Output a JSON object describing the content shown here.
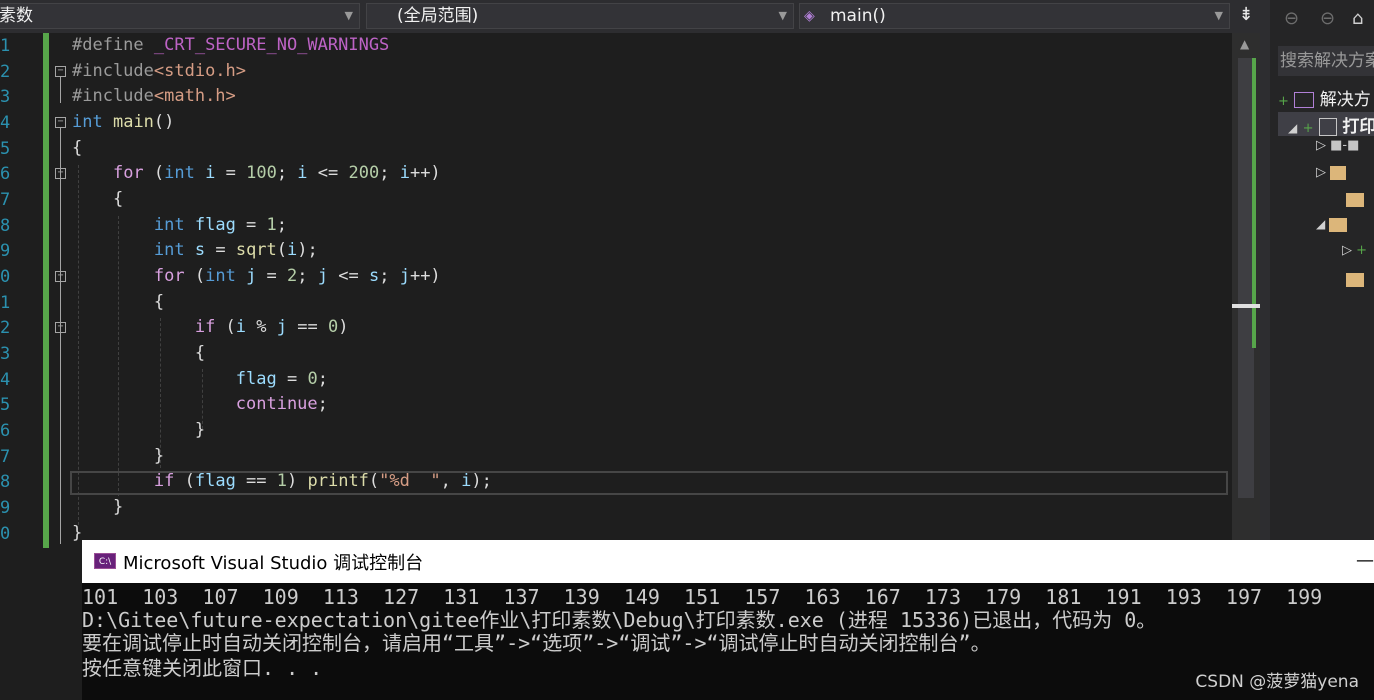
{
  "navbar": {
    "project_combo": "素数",
    "scope_combo": "(全局范围)",
    "function_combo": "main()",
    "split_icon": "split-icon"
  },
  "editor": {
    "line_numbers": [
      "1",
      "2",
      "3",
      "4",
      "5",
      "6",
      "7",
      "8",
      "9",
      "0",
      "1",
      "2",
      "3",
      "4",
      "5",
      "6",
      "7",
      "8",
      "9",
      "0"
    ],
    "lines": [
      "#define _CRT_SECURE_NO_WARNINGS",
      "#include<stdio.h>",
      "#include<math.h>",
      "int main()",
      "{",
      "    for (int i = 100; i <= 200; i++)",
      "    {",
      "        int flag = 1;",
      "        int s = sqrt(i);",
      "        for (int j = 2; j <= s; j++)",
      "        {",
      "            if (i % j == 0)",
      "            {",
      "                flag = 0;",
      "                continue;",
      "            }",
      "        }",
      "        if (flag == 1) printf(\"%d  \", i);",
      "    }",
      "}"
    ]
  },
  "solution_explorer": {
    "search_placeholder": "搜索解决方案",
    "solution_label": "解决方",
    "project_label": "打印",
    "colors": {
      "accent": "#68217a"
    }
  },
  "console": {
    "title": "Microsoft Visual Studio 调试控制台",
    "minimize": "—",
    "output_numbers": "101  103  107  109  113  127  131  137  139  149  151  157  163  167  173  179  181  191  193  197  199",
    "exit_line": "D:\\Gitee\\future-expectation\\gitee作业\\打印素数\\Debug\\打印素数.exe (进程 15336)已退出，代码为 0。",
    "hint_line": "要在调试停止时自动关闭控制台，请启用“工具”->“选项”->“调试”->“调试停止时自动关闭控制台”。",
    "press_line": "按任意键关闭此窗口. . ."
  },
  "watermark": "CSDN @菠萝猫yena"
}
